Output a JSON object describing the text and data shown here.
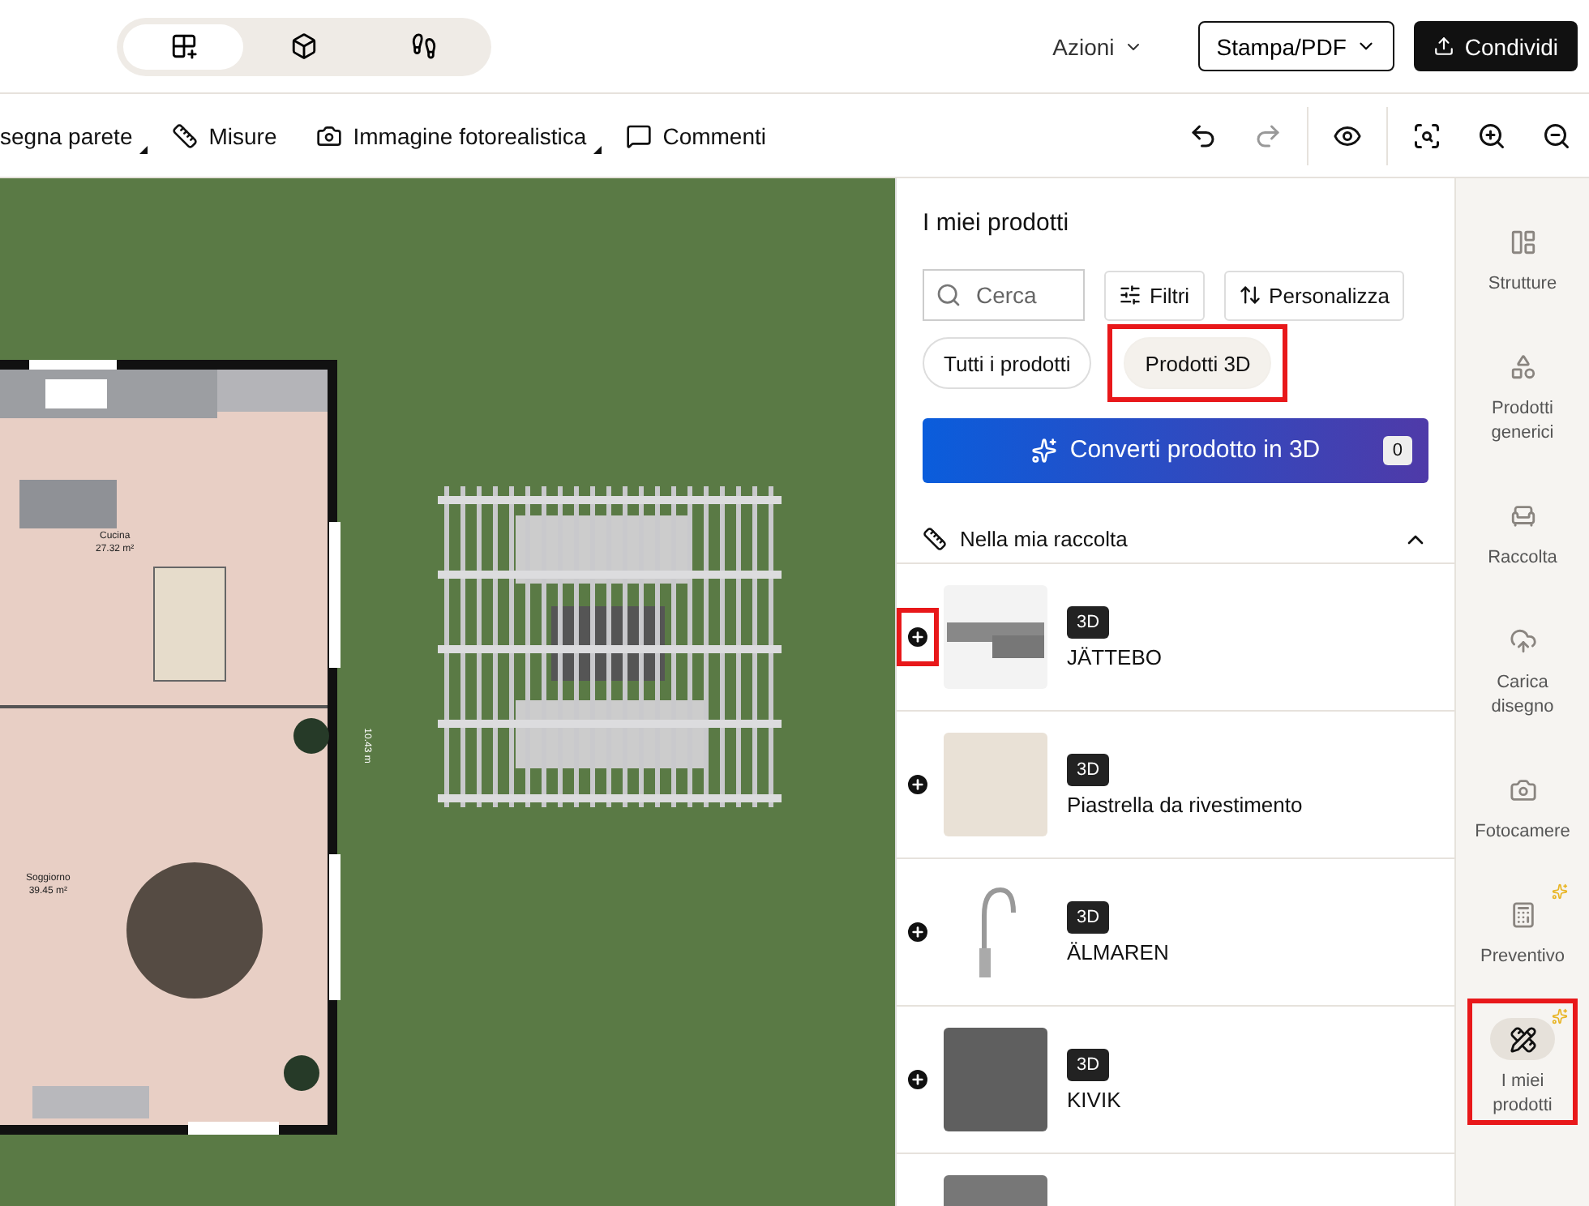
{
  "view_switcher": [
    {
      "kind": "plan",
      "selected": true
    },
    {
      "kind": "box",
      "selected": false
    },
    {
      "kind": "walk",
      "selected": false
    }
  ],
  "header_actions": {
    "menu": "Azioni",
    "print": "Stampa/PDF",
    "share": "Condividi"
  },
  "toolbar": [
    {
      "label": "segna parete",
      "dropdown": true
    },
    {
      "kind": "ruler",
      "label": "Misure",
      "dropdown": false
    },
    {
      "kind": "camera",
      "label": "Immagine fotorealistica",
      "dropdown": true
    },
    {
      "kind": "comment",
      "label": "Commenti",
      "dropdown": false
    }
  ],
  "toolbar_right": [
    {
      "kind": "undo",
      "disabled": false
    },
    {
      "kind": "redo",
      "disabled": true
    },
    {
      "kind": "eye",
      "disabled": false
    },
    {
      "kind": "focus",
      "disabled": false
    },
    {
      "kind": "zoom-in",
      "disabled": false
    },
    {
      "kind": "zoom-out",
      "disabled": false
    }
  ],
  "plan": {
    "rooms": [
      {
        "name": "Cucina",
        "area": "27.32 m²"
      },
      {
        "name": "Soggiorno",
        "area": "39.45 m²"
      }
    ],
    "dimension": "10.43 m"
  },
  "panel": {
    "title": "I miei prodotti",
    "search": {
      "placeholder": "Cerca"
    },
    "filter": "Filtri",
    "customize": "Personalizza",
    "chips": [
      {
        "label": "Tutti i prodotti",
        "selected": false,
        "highlighted": false
      },
      {
        "label": "Prodotti 3D",
        "selected": true,
        "highlighted": true
      }
    ],
    "convert": {
      "label": "Converti prodotto in 3D",
      "count": "0"
    },
    "section": {
      "title": "Nella mia raccolta",
      "expanded": true
    },
    "products": [
      {
        "kind": "sofa",
        "badge": "3D",
        "name": "JÄTTEBO",
        "highlighted": true
      },
      {
        "kind": "bath",
        "badge": "3D",
        "name": "Piastrella da rivestimento",
        "highlighted": false
      },
      {
        "kind": "tap",
        "badge": "3D",
        "name": "ÄLMAREN",
        "highlighted": false
      },
      {
        "kind": "armchair",
        "badge": "3D",
        "name": "KIVIK",
        "highlighted": false
      },
      {
        "kind": "partial"
      }
    ]
  },
  "rail": [
    {
      "kind": "structures",
      "label": "Strutture",
      "selected": false,
      "sparkle": false,
      "highlighted": false
    },
    {
      "kind": "generic",
      "label": "Prodotti generici",
      "selected": false,
      "sparkle": false,
      "highlighted": false
    },
    {
      "kind": "collection",
      "label": "Raccolta",
      "selected": false,
      "sparkle": false,
      "highlighted": false
    },
    {
      "kind": "upload",
      "label": "Carica disegno",
      "selected": false,
      "sparkle": false,
      "highlighted": false
    },
    {
      "kind": "cameras",
      "label": "Fotocamere",
      "selected": false,
      "sparkle": false,
      "highlighted": false
    },
    {
      "kind": "estimate",
      "label": "Preventivo",
      "selected": false,
      "sparkle": true,
      "highlighted": false
    },
    {
      "kind": "myproducts",
      "label": "I miei prodotti",
      "selected": true,
      "sparkle": true,
      "highlighted": true
    }
  ]
}
